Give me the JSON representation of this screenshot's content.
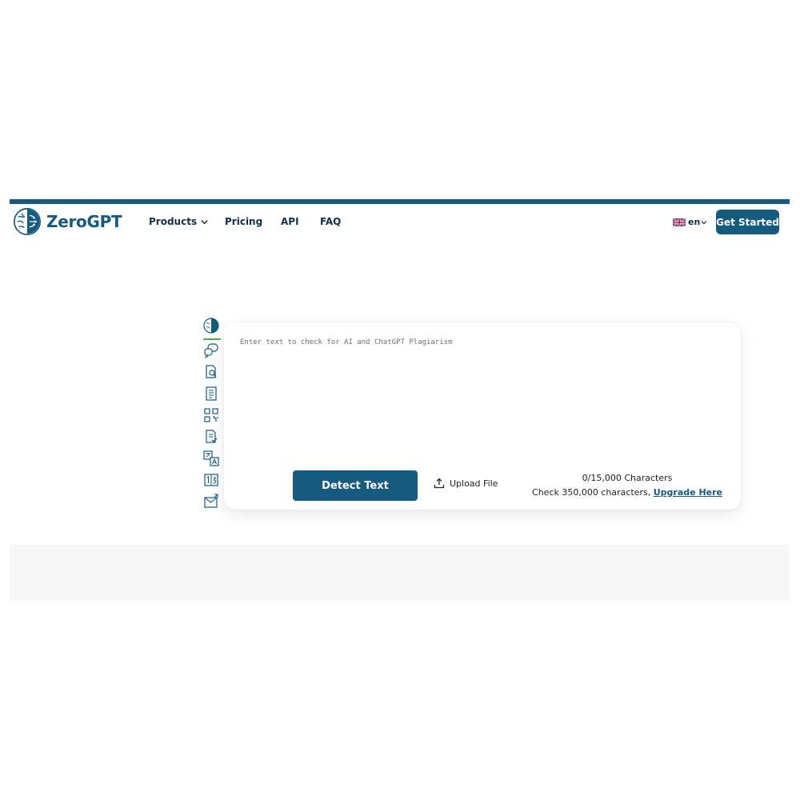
{
  "brand": {
    "name": "ZeroGPT",
    "color": "#155a7f"
  },
  "nav": {
    "products": "Products",
    "pricing": "Pricing",
    "api": "API",
    "faq": "FAQ"
  },
  "language": {
    "code": "en",
    "flag_icon": "uk-flag-icon"
  },
  "cta": {
    "label": "Get Started"
  },
  "tools": [
    "brain-detector-icon",
    "ai-chat-icon",
    "document-search-icon",
    "document-list-icon",
    "qr-code-icon",
    "document-check-icon",
    "translate-icon",
    "word-counter-icon",
    "email-icon"
  ],
  "detector": {
    "placeholder": "Enter text to check for AI and ChatGPT Plagiarism",
    "detect_label": "Detect Text",
    "upload_label": "Upload File",
    "char_count": "0/15,000 Characters",
    "upgrade_prefix": "Check 350,000 characters, ",
    "upgrade_link": "Upgrade Here"
  },
  "colors": {
    "accent": "#155a7f",
    "active_indicator": "#4caf50",
    "band": "#f7f7f7"
  }
}
